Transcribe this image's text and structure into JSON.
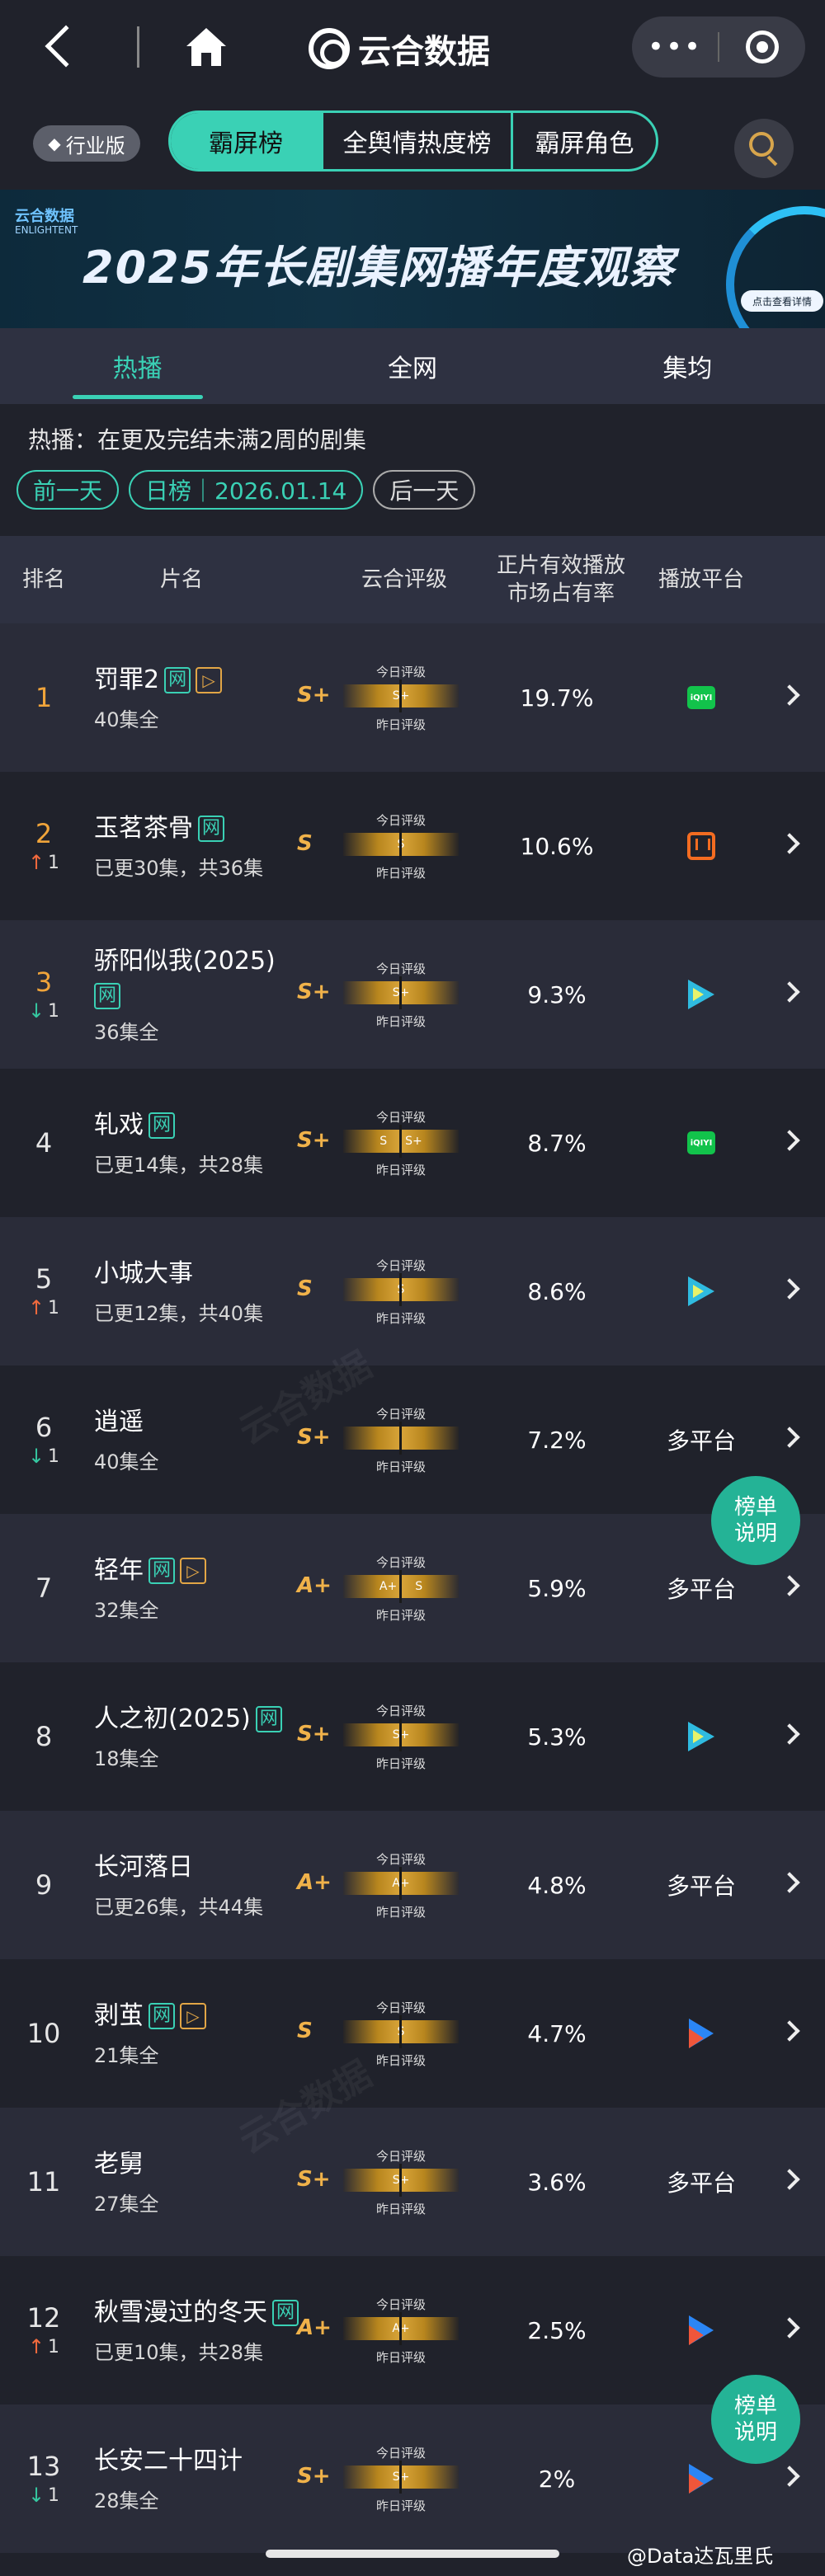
{
  "nav": {
    "title": "云合数据",
    "more": "•••"
  },
  "tabbar": {
    "industry": "行业版",
    "tabs": [
      "霸屏榜",
      "全舆情热度榜",
      "霸屏角色"
    ]
  },
  "banner": {
    "logo": "云合数据",
    "logo_sub": "ENLIGHTENT",
    "title": "2025年长剧集网播年度观察",
    "button": "点击查看详情"
  },
  "subtabs": [
    "热播",
    "全网",
    "集均"
  ],
  "description": "热播：在更及完结未满2周的剧集",
  "datebar": {
    "prev": "前一天",
    "current": "日榜｜2026.01.14",
    "next": "后一天"
  },
  "columns": {
    "rank": "排名",
    "title": "片名",
    "grade": "云合评级",
    "share": "正片有效播放\n市场占有率",
    "platform": "播放平台"
  },
  "gauge_labels": {
    "today": "今日评级",
    "yesterday": "昨日评级"
  },
  "rows": [
    {
      "rank": "1",
      "change": "",
      "dir": "",
      "title": "罚罪2",
      "tags": [
        "网",
        "▷"
      ],
      "episodes": "40集全",
      "grade": "S+",
      "bar": "S+",
      "bar2": "",
      "share": "19.7%",
      "platform": "iqiyi",
      "platform_text": ""
    },
    {
      "rank": "2",
      "change": "1",
      "dir": "up",
      "title": "玉茗茶骨",
      "tags": [
        "网"
      ],
      "episodes": "已更30集，共36集",
      "grade": "S",
      "bar": "S",
      "bar2": "",
      "share": "10.6%",
      "platform": "mgtv",
      "platform_text": ""
    },
    {
      "rank": "3",
      "change": "1",
      "dir": "down",
      "title": "骄阳似我(2025)",
      "tags": [
        "网"
      ],
      "episodes": "36集全",
      "grade": "S+",
      "bar": "S+",
      "bar2": "",
      "share": "9.3%",
      "platform": "tencent",
      "platform_text": ""
    },
    {
      "rank": "4",
      "change": "",
      "dir": "",
      "title": "轧戏",
      "tags": [
        "网"
      ],
      "episodes": "已更14集，共28集",
      "grade": "S+",
      "bar": "S",
      "bar2": "S+",
      "share": "8.7%",
      "platform": "iqiyi",
      "platform_text": ""
    },
    {
      "rank": "5",
      "change": "1",
      "dir": "up",
      "title": "小城大事",
      "tags": [],
      "episodes": "已更12集，共40集",
      "grade": "S",
      "bar": "S",
      "bar2": "",
      "share": "8.6%",
      "platform": "tencent",
      "platform_text": ""
    },
    {
      "rank": "6",
      "change": "1",
      "dir": "down",
      "title": "逍遥",
      "tags": [],
      "episodes": "40集全",
      "grade": "S+",
      "bar": "",
      "bar2": "",
      "share": "7.2%",
      "platform": "",
      "platform_text": "多平台"
    },
    {
      "rank": "7",
      "change": "",
      "dir": "",
      "title": "轻年",
      "tags": [
        "网",
        "▷"
      ],
      "episodes": "32集全",
      "grade": "A+",
      "bar": "A+",
      "bar2": "S",
      "share": "5.9%",
      "platform": "",
      "platform_text": "多平台"
    },
    {
      "rank": "8",
      "change": "",
      "dir": "",
      "title": "人之初(2025)",
      "tags": [
        "网"
      ],
      "episodes": "18集全",
      "grade": "S+",
      "bar": "S+",
      "bar2": "",
      "share": "5.3%",
      "platform": "tencent",
      "platform_text": ""
    },
    {
      "rank": "9",
      "change": "",
      "dir": "",
      "title": "长河落日",
      "tags": [],
      "episodes": "已更26集，共44集",
      "grade": "A+",
      "bar": "A+",
      "bar2": "",
      "share": "4.8%",
      "platform": "",
      "platform_text": "多平台"
    },
    {
      "rank": "10",
      "change": "",
      "dir": "",
      "title": "剥茧",
      "tags": [
        "网",
        "▷"
      ],
      "episodes": "21集全",
      "grade": "S",
      "bar": "S",
      "bar2": "",
      "share": "4.7%",
      "platform": "youku",
      "platform_text": ""
    },
    {
      "rank": "11",
      "change": "",
      "dir": "",
      "title": "老舅",
      "tags": [],
      "episodes": "27集全",
      "grade": "S+",
      "bar": "S+",
      "bar2": "",
      "share": "3.6%",
      "platform": "",
      "platform_text": "多平台"
    },
    {
      "rank": "12",
      "change": "1",
      "dir": "up",
      "title": "秋雪漫过的冬天",
      "tags": [
        "网"
      ],
      "episodes": "已更10集，共28集",
      "grade": "A+",
      "bar": "A+",
      "bar2": "",
      "share": "2.5%",
      "platform": "youku",
      "platform_text": ""
    },
    {
      "rank": "13",
      "change": "1",
      "dir": "down",
      "title": "长安二十四计",
      "tags": [],
      "episodes": "28集全",
      "grade": "S+",
      "bar": "S+",
      "bar2": "",
      "share": "2%",
      "platform": "youku",
      "platform_text": ""
    }
  ],
  "float_button": "榜单说明",
  "weibo_mark": "@Data达瓦里氏",
  "colors": {
    "accent": "#3ad1b5",
    "grade": "#f0b24a",
    "up": "#f26a3d",
    "down": "#35c7a0"
  }
}
